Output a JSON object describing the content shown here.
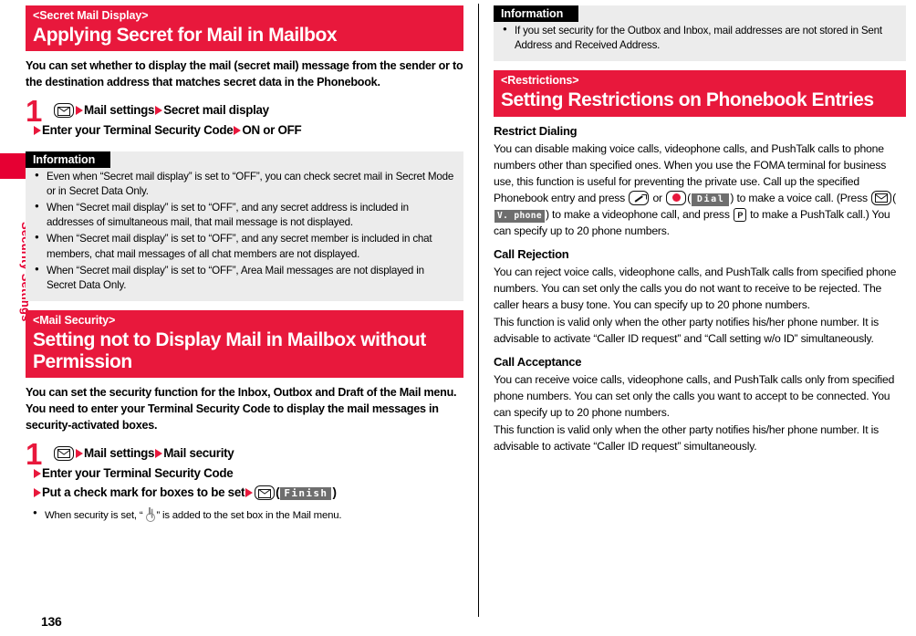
{
  "sidebar": {
    "chapter_label": "Security Settings",
    "tab_color": "#e60033"
  },
  "footer": {
    "page_number": "136"
  },
  "colors": {
    "accent_red": "#e8183c",
    "info_bg": "#ececec",
    "chip_gray": "#6e6e6e"
  },
  "left_column": {
    "section1": {
      "kicker": "<Secret Mail Display>",
      "title": "Applying Secret for Mail in Mailbox",
      "lead": "You can set whether to display the mail (secret mail) message from the sender or to the destination address that matches secret data in the Phonebook.",
      "step_number": "1",
      "step_line1_a": "Mail settings",
      "step_line1_b": "Secret mail display",
      "step_line2_a": "Enter your Terminal Security Code",
      "step_line2_b": "ON or OFF",
      "info": {
        "heading": "Information",
        "items": [
          "Even when “Secret mail display” is set to “OFF”, you can check secret mail in Secret Mode or in Secret Data Only.",
          "When “Secret mail display” is set to “OFF”, and any secret address is included in addresses of simultaneous mail, that mail message is not displayed.",
          "When “Secret mail display” is set to “OFF”, and any secret member is included in chat members, chat mail messages of all chat members are not displayed.",
          "When “Secret mail display” is set to “OFF”, Area Mail messages are not displayed in Secret Data Only."
        ]
      }
    },
    "section2": {
      "kicker": "<Mail Security>",
      "title": "Setting not to Display Mail in Mailbox without Permission",
      "lead_p1": "You can set the security function for the Inbox, Outbox and Draft of the Mail menu.",
      "lead_p2": "You need to enter your Terminal Security Code to display the mail messages in security-activated boxes.",
      "step_number": "1",
      "step_line1_a": "Mail settings",
      "step_line1_b": "Mail security",
      "step_line2": "Enter your Terminal Security Code",
      "step_line3": "Put a check mark for boxes to be set",
      "finish_key_label": "Finish",
      "note_before": "When security is set, “",
      "note_after": "” is added to the set box in the Mail menu."
    }
  },
  "right_column": {
    "info_top": {
      "heading": "Information",
      "items": [
        "If you set security for the Outbox and Inbox, mail addresses are not stored in Sent Address and Received Address."
      ]
    },
    "section3": {
      "kicker": "<Restrictions>",
      "title": "Setting Restrictions on Phonebook Entries",
      "blocks": [
        {
          "heading": "Restrict Dialing",
          "text_a": "You can disable making voice calls, videophone calls, and PushTalk calls to phone numbers other than specified ones. When you use the FOMA terminal for business use, this function is useful for preventing the private use. Call up the specified Phonebook entry and press",
          "text_or": "or",
          "dial_chip": "Dial",
          "text_b": ") to make a voice call. (Press",
          "vphone_chip": "V. phone",
          "text_c": ") to make a videophone call, and press",
          "text_d": "to make a PushTalk call.) You can specify up to 20 phone numbers."
        },
        {
          "heading": "Call Rejection",
          "para1": "You can reject voice calls, videophone calls, and PushTalk calls from specified phone numbers. You can set only the calls you do not want to receive to be rejected. The caller hears a busy tone. You can specify up to 20 phone numbers.",
          "para2": "This function is valid only when the other party notifies his/her phone number. It is advisable to activate “Caller ID request” and “Call setting w/o ID” simultaneously."
        },
        {
          "heading": "Call Acceptance",
          "para1": "You can receive voice calls, videophone calls, and PushTalk calls only from specified phone numbers. You can set only the calls you want to accept to be connected. You can specify up to 20 phone numbers.",
          "para2": "This function is valid only when the other party notifies his/her phone number. It is advisable to activate “Caller ID request” simultaneously."
        }
      ]
    }
  }
}
